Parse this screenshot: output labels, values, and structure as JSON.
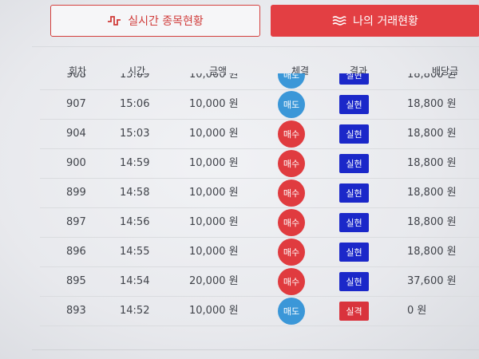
{
  "tabs": {
    "realtime": {
      "label": "실시간 종목현황",
      "icon": "pulse-wave-icon"
    },
    "my_trades": {
      "label": "나의 거래현황",
      "icon": "waves-icon"
    }
  },
  "table": {
    "headers": [
      "회차",
      "시간",
      "금액",
      "체결",
      "결과",
      "배당금"
    ],
    "rows": [
      {
        "round": "908",
        "time": "15:09",
        "amount": "10,000 원",
        "direction": "매도",
        "direction_type": "sell",
        "result": "실현",
        "result_type": "win",
        "payout": "18,800 원"
      },
      {
        "round": "907",
        "time": "15:06",
        "amount": "10,000 원",
        "direction": "매도",
        "direction_type": "sell",
        "result": "실현",
        "result_type": "win",
        "payout": "18,800 원"
      },
      {
        "round": "904",
        "time": "15:03",
        "amount": "10,000 원",
        "direction": "매수",
        "direction_type": "buy",
        "result": "실현",
        "result_type": "win",
        "payout": "18,800 원"
      },
      {
        "round": "900",
        "time": "14:59",
        "amount": "10,000 원",
        "direction": "매수",
        "direction_type": "buy",
        "result": "실현",
        "result_type": "win",
        "payout": "18,800 원"
      },
      {
        "round": "899",
        "time": "14:58",
        "amount": "10,000 원",
        "direction": "매수",
        "direction_type": "buy",
        "result": "실현",
        "result_type": "win",
        "payout": "18,800 원"
      },
      {
        "round": "897",
        "time": "14:56",
        "amount": "10,000 원",
        "direction": "매수",
        "direction_type": "buy",
        "result": "실현",
        "result_type": "win",
        "payout": "18,800 원"
      },
      {
        "round": "896",
        "time": "14:55",
        "amount": "10,000 원",
        "direction": "매수",
        "direction_type": "buy",
        "result": "실현",
        "result_type": "win",
        "payout": "18,800 원"
      },
      {
        "round": "895",
        "time": "14:54",
        "amount": "20,000 원",
        "direction": "매수",
        "direction_type": "buy",
        "result": "실현",
        "result_type": "win",
        "payout": "37,600 원"
      },
      {
        "round": "893",
        "time": "14:52",
        "amount": "10,000 원",
        "direction": "매도",
        "direction_type": "sell",
        "result": "실격",
        "result_type": "lose",
        "payout": "0 원"
      }
    ]
  },
  "colors": {
    "accent_red": "#e33f43",
    "sell_blue": "#3b97d8",
    "buy_red": "#e03b3f",
    "win_blue": "#1b28c9",
    "lose_red": "#d9333c"
  }
}
